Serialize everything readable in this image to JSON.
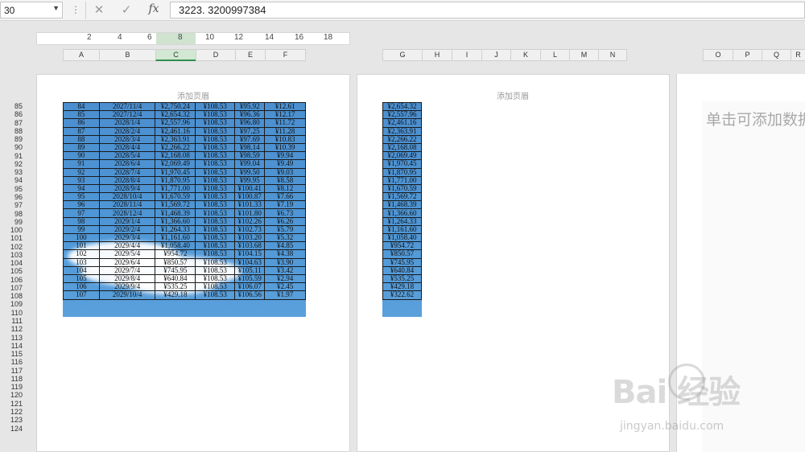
{
  "formula_bar": {
    "name_box": "30",
    "cancel_icon": "✕",
    "enter_icon": "✓",
    "fx_label": "fx",
    "formula_value": "3223. 3200997384"
  },
  "ruler": {
    "labels": [
      "2",
      "4",
      "6",
      "8",
      "10",
      "12",
      "14",
      "16",
      "18"
    ]
  },
  "columns_left": [
    "A",
    "B",
    "C",
    "D",
    "E",
    "F"
  ],
  "columns_right": [
    "G",
    "H",
    "I",
    "J",
    "K",
    "L",
    "M",
    "N"
  ],
  "columns_far": [
    "O",
    "P",
    "Q",
    "R"
  ],
  "header_placeholder": "添加页眉",
  "page3_placeholder": "单击可添加数据",
  "rows": [
    "85",
    "86",
    "87",
    "88",
    "89",
    "90",
    "91",
    "92",
    "93",
    "94",
    "95",
    "96",
    "97",
    "98",
    "99",
    "100",
    "101",
    "102",
    "103",
    "104",
    "105",
    "106",
    "107",
    "108",
    "109",
    "110",
    "111",
    "112",
    "113",
    "114",
    "115",
    "116",
    "117",
    "118",
    "119",
    "120",
    "121",
    "122",
    "123",
    "124"
  ],
  "table": [
    [
      "84",
      "2027/11/4",
      "¥2,750.24",
      "¥108.53",
      "¥95.92",
      "¥12.61"
    ],
    [
      "85",
      "2027/12/4",
      "¥2,654.32",
      "¥108.53",
      "¥96.36",
      "¥12.17"
    ],
    [
      "86",
      "2028/1/4",
      "¥2,557.96",
      "¥108.53",
      "¥96.80",
      "¥11.72"
    ],
    [
      "87",
      "2028/2/4",
      "¥2,461.16",
      "¥108.53",
      "¥97.25",
      "¥11.28"
    ],
    [
      "88",
      "2028/3/4",
      "¥2,363.91",
      "¥108.53",
      "¥97.69",
      "¥10.83"
    ],
    [
      "89",
      "2028/4/4",
      "¥2,266.22",
      "¥108.53",
      "¥98.14",
      "¥10.39"
    ],
    [
      "90",
      "2028/5/4",
      "¥2,168.08",
      "¥108.53",
      "¥98.59",
      "¥9.94"
    ],
    [
      "91",
      "2028/6/4",
      "¥2,069.49",
      "¥108.53",
      "¥99.04",
      "¥9.49"
    ],
    [
      "92",
      "2028/7/4",
      "¥1,970.45",
      "¥108.53",
      "¥99.50",
      "¥9.03"
    ],
    [
      "93",
      "2028/8/4",
      "¥1,870.95",
      "¥108.53",
      "¥99.95",
      "¥8.58"
    ],
    [
      "94",
      "2028/9/4",
      "¥1,771.00",
      "¥108.53",
      "¥100.41",
      "¥8.12"
    ],
    [
      "95",
      "2028/10/4",
      "¥1,670.59",
      "¥108.53",
      "¥100.87",
      "¥7.66"
    ],
    [
      "96",
      "2028/11/4",
      "¥1,569.72",
      "¥108.53",
      "¥101.33",
      "¥7.19"
    ],
    [
      "97",
      "2028/12/4",
      "¥1,468.39",
      "¥108.53",
      "¥101.80",
      "¥6.73"
    ],
    [
      "98",
      "2029/1/4",
      "¥1,366.60",
      "¥108.53",
      "¥102.26",
      "¥6.26"
    ],
    [
      "99",
      "2029/2/4",
      "¥1,264.33",
      "¥108.53",
      "¥102.73",
      "¥5.79"
    ],
    [
      "100",
      "2029/3/4",
      "¥1,161.60",
      "¥108.53",
      "¥103.20",
      "¥5.32"
    ],
    [
      "101",
      "2029/4/4",
      "¥1,058.40",
      "¥108.53",
      "¥103.68",
      "¥4.85"
    ],
    [
      "102",
      "2029/5/4",
      "¥954.72",
      "¥108.53",
      "¥104.15",
      "¥4.38"
    ],
    [
      "103",
      "2029/6/4",
      "¥850.57",
      "¥108.53",
      "¥104.63",
      "¥3.90"
    ],
    [
      "104",
      "2029/7/4",
      "¥745.95",
      "¥108.53",
      "¥105.11",
      "¥3.42"
    ],
    [
      "105",
      "2029/8/4",
      "¥640.84",
      "¥108.53",
      "¥105.59",
      "¥2.94"
    ],
    [
      "106",
      "2029/9/4",
      "¥535.25",
      "¥108.53",
      "¥106.07",
      "¥2.45"
    ],
    [
      "107",
      "2029/10/4",
      "¥429.18",
      "¥108.53",
      "¥106.56",
      "¥1.97"
    ]
  ],
  "table_g": [
    "¥2,654.32",
    "¥2,557.96",
    "¥2,461.16",
    "¥2,363.91",
    "¥2,266.22",
    "¥2,168.08",
    "¥2,069.49",
    "¥1,970.45",
    "¥1,870.95",
    "¥1,771.00",
    "¥1,670.59",
    "¥1,569.72",
    "¥1,468.39",
    "¥1,366.60",
    "¥1,264.33",
    "¥1,161.60",
    "¥1,058.40",
    "¥954.72",
    "¥850.57",
    "¥745.95",
    "¥640.84",
    "¥535.25",
    "¥429.18",
    "¥322.62"
  ],
  "watermark": {
    "brand": "Bai  经验",
    "url": "jingyan.baidu.com"
  },
  "colors": {
    "cell_fill": "#4f97d6",
    "selected_col": "#d2e8d2",
    "selected_border": "#2f8f4f"
  }
}
